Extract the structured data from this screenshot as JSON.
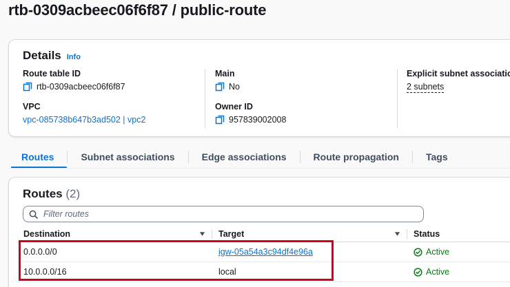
{
  "page": {
    "title": "rtb-0309acbeec06f6f87 / public-route"
  },
  "details": {
    "title": "Details",
    "info_label": "Info",
    "route_table_id": {
      "label": "Route table ID",
      "value": "rtb-0309acbeec06f6f87"
    },
    "vpc": {
      "label": "VPC",
      "value": "vpc-085738b647b3ad502 | vpc2"
    },
    "main": {
      "label": "Main",
      "value": "No"
    },
    "owner_id": {
      "label": "Owner ID",
      "value": "957839002008"
    },
    "explicit_subnet": {
      "label": "Explicit subnet associations",
      "value": "2 subnets"
    }
  },
  "tabs": [
    {
      "label": "Routes",
      "active": true
    },
    {
      "label": "Subnet associations",
      "active": false
    },
    {
      "label": "Edge associations",
      "active": false
    },
    {
      "label": "Route propagation",
      "active": false
    },
    {
      "label": "Tags",
      "active": false
    }
  ],
  "routes": {
    "title": "Routes",
    "count": "(2)",
    "filter_placeholder": "Filter routes",
    "columns": {
      "destination": "Destination",
      "target": "Target",
      "status": "Status"
    },
    "rows": [
      {
        "destination": "0.0.0.0/0",
        "target": "igw-05a54a3c94df4e96a",
        "target_is_link": true,
        "status": "Active"
      },
      {
        "destination": "10.0.0.0/16",
        "target": "local",
        "target_is_link": false,
        "status": "Active"
      }
    ]
  },
  "colors": {
    "link": "#0972d3",
    "success": "#037f0c",
    "highlight": "#d0021b"
  },
  "icons": {
    "copy": "copy-icon",
    "search": "search-icon",
    "sort": "sort-down-icon",
    "status": "check-circle-icon"
  }
}
